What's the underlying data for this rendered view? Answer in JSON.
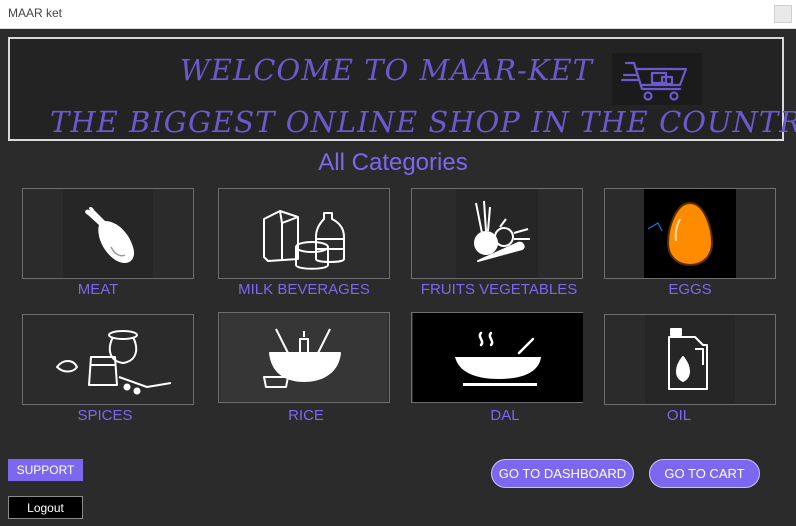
{
  "window": {
    "title": "MAAR ket"
  },
  "banner": {
    "line1": "WELCOME TO MAAR-KET",
    "line2": "THE BIGGEST ONLINE SHOP IN THE COUNTRY",
    "icon": "shopping-cart-icon"
  },
  "categories_title": "All Categories",
  "categories": [
    {
      "label": "MEAT",
      "icon": "chicken-leg-icon"
    },
    {
      "label": "MILK  BEVERAGES",
      "icon": "milk-bottles-icon"
    },
    {
      "label": "FRUITS  VEGETABLES",
      "icon": "vegetables-icon"
    },
    {
      "label": "EGGS",
      "icon": "egg-icon"
    },
    {
      "label": "SPICES",
      "icon": "spice-jars-icon"
    },
    {
      "label": "RICE",
      "icon": "rice-bowl-icon"
    },
    {
      "label": "DAL",
      "icon": "steaming-bowl-icon"
    },
    {
      "label": "OIL",
      "icon": "oil-can-icon"
    }
  ],
  "buttons": {
    "support": "SUPPORT",
    "logout": "Logout",
    "dashboard": "GO TO DASHBOARD",
    "cart": "GO TO CART"
  },
  "colors": {
    "accent": "#7b68ee",
    "banner_text": "#6a5acd",
    "background": "#2b2b2b",
    "egg": "#ff8c00"
  }
}
